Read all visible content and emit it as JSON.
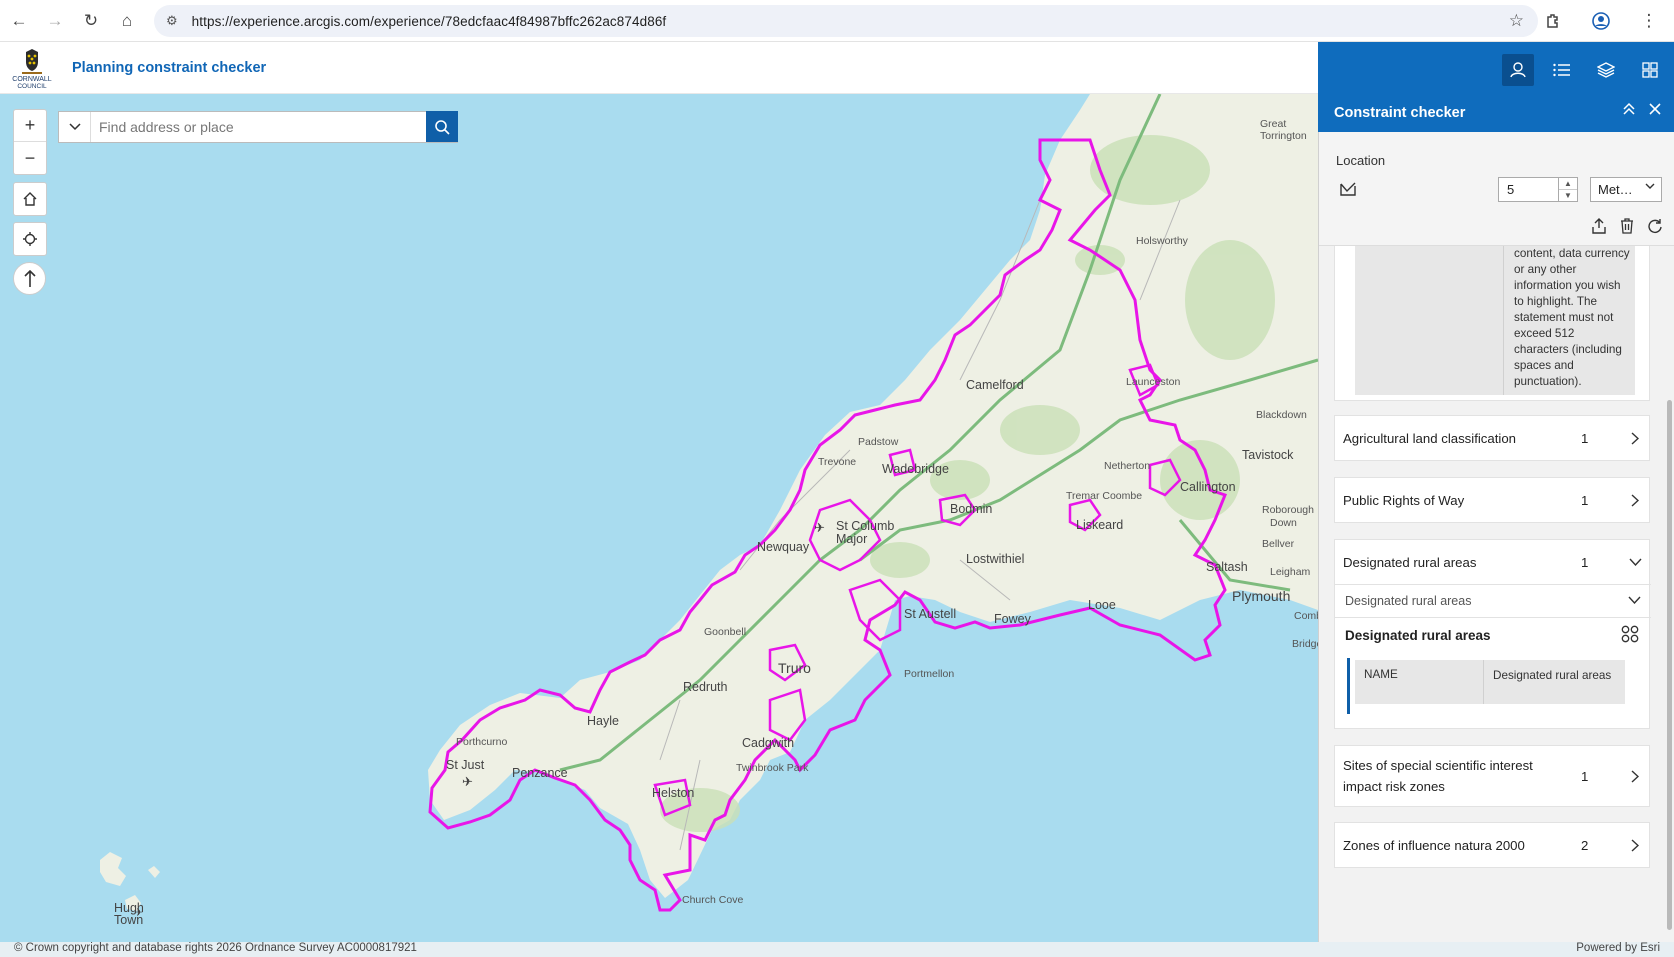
{
  "browser": {
    "url": "https://experience.arcgis.com/experience/78edcfaac4f84987bffc262ac874d86f"
  },
  "app": {
    "logo_text_1": "CORNWALL",
    "logo_text_2": "COUNCIL",
    "title": "Planning constraint checker"
  },
  "search": {
    "placeholder": "Find address or place"
  },
  "map": {
    "labels": [
      "Great Torrington",
      "Holsworthy",
      "Camelford",
      "Launceston",
      "Blackdown",
      "Padstow",
      "Trevone",
      "Wadebridge",
      "Bodmin",
      "Liskeard",
      "Callington",
      "Tavistock",
      "Roborough",
      "Down",
      "Bellver",
      "Newquay",
      "St Columb Major",
      "Lostwithiel",
      "Saltash",
      "Plymouth",
      "Looe",
      "Fowey",
      "St Austell",
      "Goonbell",
      "Truro",
      "Redruth",
      "Portmellon",
      "Hayle",
      "Porthcurno",
      "St Just",
      "Penzance",
      "Helston",
      "Twinbrook Park",
      "Cadgwith",
      "Church Cove",
      "Hugh Town",
      "Netherton",
      "Tremar Coombe",
      "Leigham",
      "Bridge",
      "Comb"
    ],
    "boundary_color": "#e815e8",
    "sea_color": "#a9dcef",
    "land_color": "#eef0e4"
  },
  "footer": {
    "copyright": "© Crown copyright and database rights 2026 Ordnance Survey AC0000817921",
    "powered": "Powered by Esri"
  },
  "panel": {
    "title": "Constraint checker",
    "location_label": "Location",
    "buffer_value": "5",
    "unit": "Met…",
    "statement": "content, data currency or any other information you wish to highlight. The statement must not exceed 512 characters (including spaces and punctuation).",
    "layers": [
      {
        "name": "Agricultural land classification",
        "count": "1",
        "expanded": false
      },
      {
        "name": "Public Rights of Way",
        "count": "1",
        "expanded": false
      },
      {
        "name": "Designated rural areas",
        "count": "1",
        "expanded": true
      },
      {
        "name": "Sites of special scientific interest impact risk zones",
        "count": "1",
        "expanded": false
      },
      {
        "name": "Zones of influence natura 2000",
        "count": "2",
        "expanded": false
      }
    ],
    "dra_sub": "Designated rural areas",
    "dra_heading": "Designated rural areas",
    "dra_field_name": "NAME",
    "dra_field_value": "Designated rural areas"
  }
}
